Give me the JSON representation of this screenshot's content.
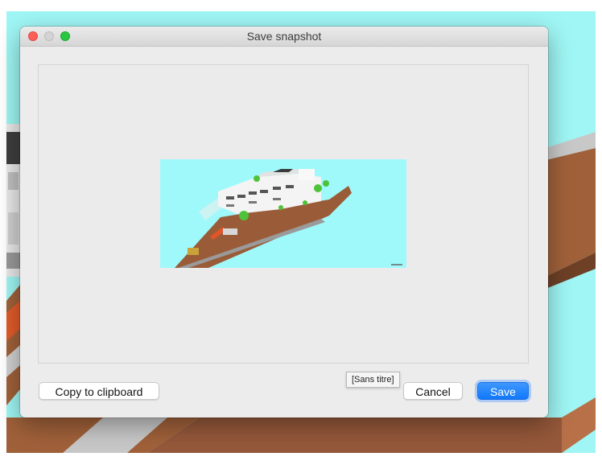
{
  "dialog": {
    "title": "Save snapshot",
    "copy_button": "Copy to clipboard",
    "cancel_button": "Cancel",
    "save_button": "Save",
    "tooltip": "[Sans titre]"
  },
  "colors": {
    "sky": "#9ff6f4",
    "accent": "#1278fb",
    "terrain": "#a0613a"
  },
  "icons": [
    "close-button",
    "minimize-button",
    "zoom-button"
  ]
}
